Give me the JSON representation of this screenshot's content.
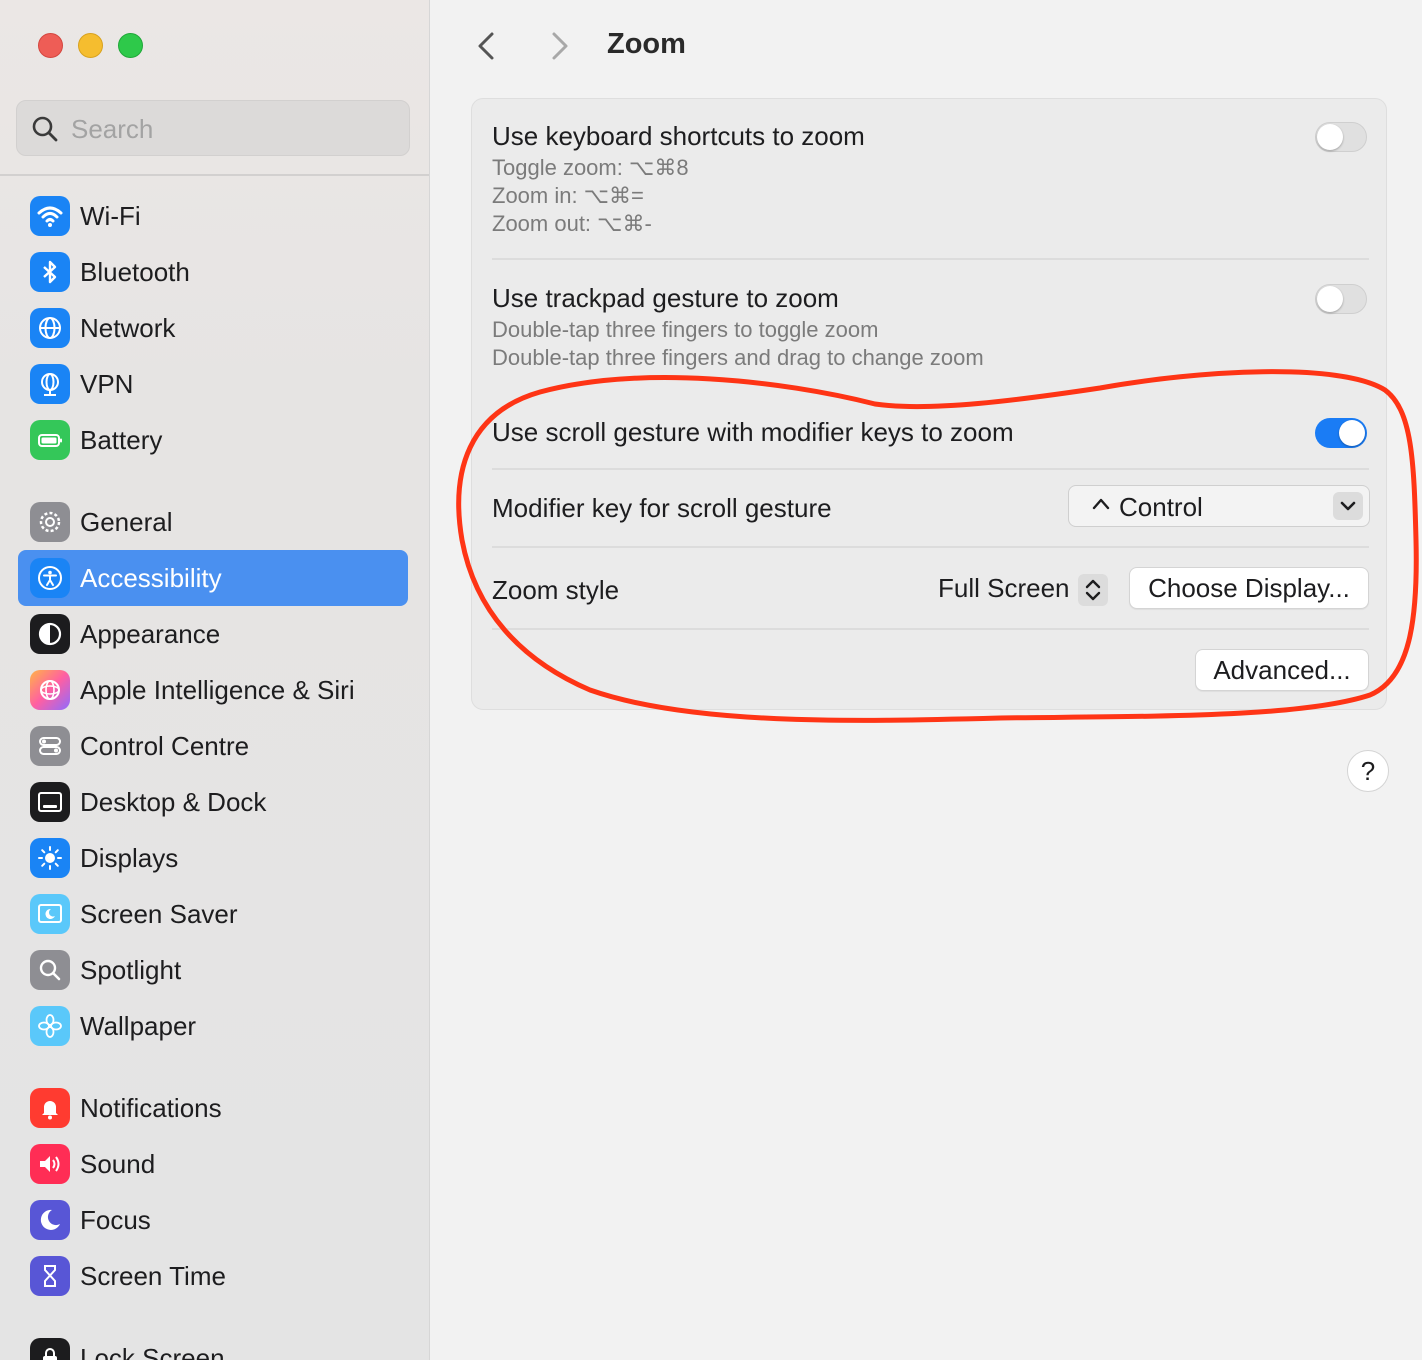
{
  "window": {
    "traffic_lights": [
      "close",
      "minimize",
      "zoom"
    ]
  },
  "search": {
    "placeholder": "Search"
  },
  "sidebar": {
    "items": [
      {
        "label": "Wi-Fi",
        "icon": "wifi-icon",
        "color": "#1a84f5"
      },
      {
        "label": "Bluetooth",
        "icon": "bluetooth-icon",
        "color": "#1a84f5"
      },
      {
        "label": "Network",
        "icon": "globe-icon",
        "color": "#1a84f5"
      },
      {
        "label": "VPN",
        "icon": "vpn-globe-icon",
        "color": "#1a84f5"
      },
      {
        "label": "Battery",
        "icon": "battery-icon",
        "color": "#34c759"
      },
      {
        "label": "General",
        "icon": "gear-icon",
        "color": "#8e8e93"
      },
      {
        "label": "Accessibility",
        "icon": "accessibility-icon",
        "color": "#1a84f5",
        "selected": true
      },
      {
        "label": "Appearance",
        "icon": "appearance-icon",
        "color": "#1c1c1e"
      },
      {
        "label": "Apple Intelligence & Siri",
        "icon": "siri-icon",
        "color": "#ff6fb5"
      },
      {
        "label": "Control Centre",
        "icon": "control-centre-icon",
        "color": "#8e8e93"
      },
      {
        "label": "Desktop & Dock",
        "icon": "desktop-dock-icon",
        "color": "#1c1c1e"
      },
      {
        "label": "Displays",
        "icon": "sun-icon",
        "color": "#1a84f5"
      },
      {
        "label": "Screen Saver",
        "icon": "screen-saver-icon",
        "color": "#5ac8fa"
      },
      {
        "label": "Spotlight",
        "icon": "magnifier-icon",
        "color": "#8e8e93"
      },
      {
        "label": "Wallpaper",
        "icon": "flower-icon",
        "color": "#5ac8fa"
      },
      {
        "label": "Notifications",
        "icon": "bell-icon",
        "color": "#ff3b30"
      },
      {
        "label": "Sound",
        "icon": "speaker-icon",
        "color": "#ff2d55"
      },
      {
        "label": "Focus",
        "icon": "moon-icon",
        "color": "#5856d6"
      },
      {
        "label": "Screen Time",
        "icon": "hourglass-icon",
        "color": "#5856d6"
      },
      {
        "label": "Lock Screen",
        "icon": "lock-icon",
        "color": "#1c1c1e"
      }
    ]
  },
  "main": {
    "title": "Zoom",
    "rows": {
      "keyboard": {
        "title": "Use keyboard shortcuts to zoom",
        "lines": [
          "Toggle zoom: ⌥⌘8",
          "Zoom in: ⌥⌘=",
          "Zoom out: ⌥⌘-"
        ],
        "enabled": false
      },
      "trackpad": {
        "title": "Use trackpad gesture to zoom",
        "lines": [
          "Double-tap three fingers to toggle zoom",
          "Double-tap three fingers and drag to change zoom"
        ],
        "enabled": false
      },
      "scroll": {
        "title": "Use scroll gesture with modifier keys to zoom",
        "enabled": true
      },
      "modifier": {
        "title": "Modifier key for scroll gesture",
        "value": "Control"
      },
      "zoom_style": {
        "title": "Zoom style",
        "value": "Full Screen",
        "choose_display_label": "Choose Display..."
      },
      "advanced_label": "Advanced..."
    },
    "help_label": "?"
  },
  "colors": {
    "accent": "#1a7cf5",
    "selection": "#4a90f0",
    "annotation": "#ff2a0a"
  }
}
